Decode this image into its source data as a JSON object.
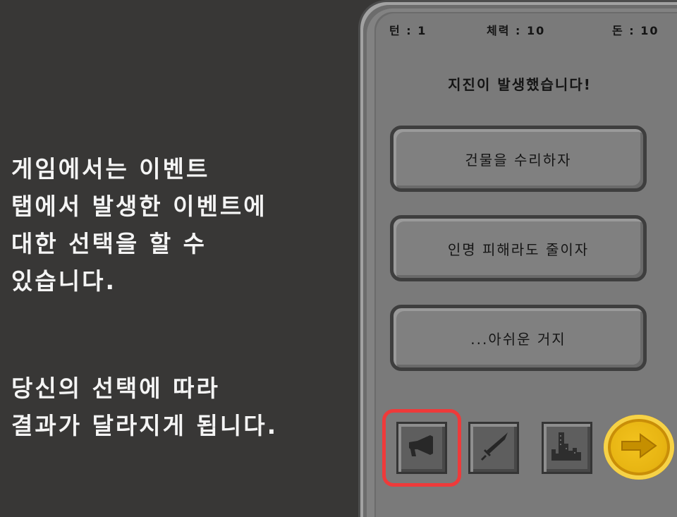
{
  "tutorial": {
    "paragraph1": "게임에서는 이벤트\n탭에서 발생한 이벤트에\n대한 선택을 할 수\n있습니다.",
    "paragraph2": "당신의 선택에 따라\n결과가 달라지게 됩니다."
  },
  "stats": {
    "turn": "턴 : 1",
    "health": "체력 : 10",
    "money": "돈 : 10"
  },
  "event": {
    "title": "지진이 발생했습니다!",
    "choices": [
      {
        "label": "건물을 수리하자"
      },
      {
        "label": "인명 피해라도 줄이자"
      },
      {
        "label": "...아쉬운 거지"
      }
    ]
  },
  "tabs": [
    {
      "icon": "megaphone-icon",
      "name": "event-tab",
      "selected": true
    },
    {
      "icon": "sword-icon",
      "name": "battle-tab",
      "selected": false
    },
    {
      "icon": "city-icon",
      "name": "city-tab",
      "selected": false
    }
  ],
  "colors": {
    "background": "#383736",
    "panel": "#808080",
    "highlight": "#ee3a3a",
    "next_button": "#e7b412"
  }
}
